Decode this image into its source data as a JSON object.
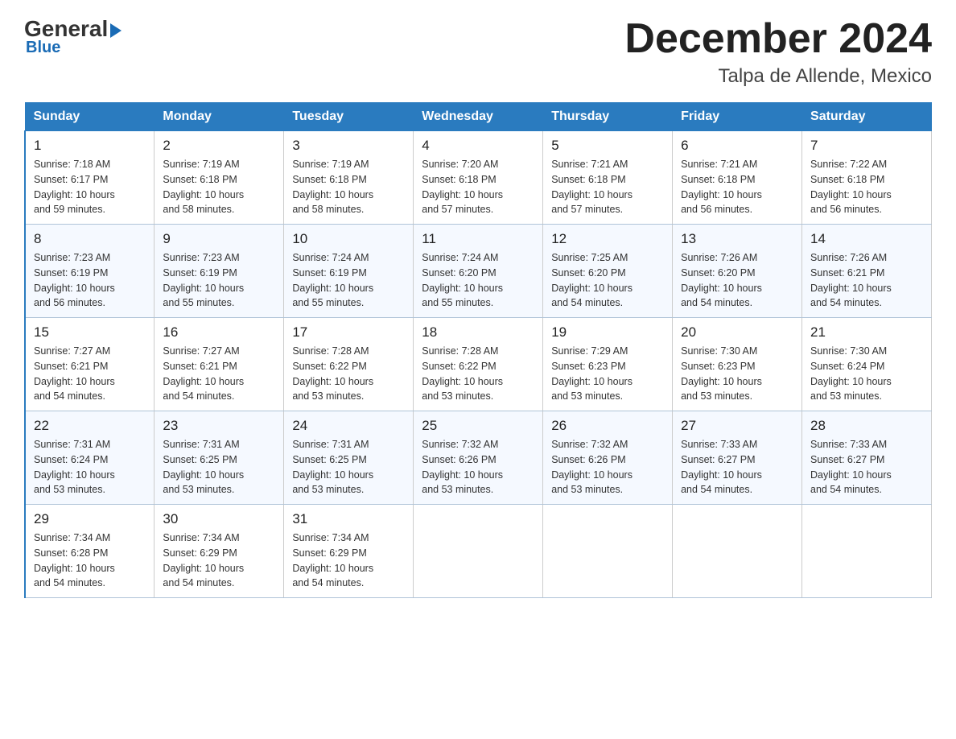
{
  "logo": {
    "general": "General",
    "blue": "Blue"
  },
  "header": {
    "month": "December 2024",
    "location": "Talpa de Allende, Mexico"
  },
  "days_of_week": [
    "Sunday",
    "Monday",
    "Tuesday",
    "Wednesday",
    "Thursday",
    "Friday",
    "Saturday"
  ],
  "weeks": [
    [
      {
        "day": "1",
        "sunrise": "7:18 AM",
        "sunset": "6:17 PM",
        "daylight": "10 hours and 59 minutes."
      },
      {
        "day": "2",
        "sunrise": "7:19 AM",
        "sunset": "6:18 PM",
        "daylight": "10 hours and 58 minutes."
      },
      {
        "day": "3",
        "sunrise": "7:19 AM",
        "sunset": "6:18 PM",
        "daylight": "10 hours and 58 minutes."
      },
      {
        "day": "4",
        "sunrise": "7:20 AM",
        "sunset": "6:18 PM",
        "daylight": "10 hours and 57 minutes."
      },
      {
        "day": "5",
        "sunrise": "7:21 AM",
        "sunset": "6:18 PM",
        "daylight": "10 hours and 57 minutes."
      },
      {
        "day": "6",
        "sunrise": "7:21 AM",
        "sunset": "6:18 PM",
        "daylight": "10 hours and 56 minutes."
      },
      {
        "day": "7",
        "sunrise": "7:22 AM",
        "sunset": "6:18 PM",
        "daylight": "10 hours and 56 minutes."
      }
    ],
    [
      {
        "day": "8",
        "sunrise": "7:23 AM",
        "sunset": "6:19 PM",
        "daylight": "10 hours and 56 minutes."
      },
      {
        "day": "9",
        "sunrise": "7:23 AM",
        "sunset": "6:19 PM",
        "daylight": "10 hours and 55 minutes."
      },
      {
        "day": "10",
        "sunrise": "7:24 AM",
        "sunset": "6:19 PM",
        "daylight": "10 hours and 55 minutes."
      },
      {
        "day": "11",
        "sunrise": "7:24 AM",
        "sunset": "6:20 PM",
        "daylight": "10 hours and 55 minutes."
      },
      {
        "day": "12",
        "sunrise": "7:25 AM",
        "sunset": "6:20 PM",
        "daylight": "10 hours and 54 minutes."
      },
      {
        "day": "13",
        "sunrise": "7:26 AM",
        "sunset": "6:20 PM",
        "daylight": "10 hours and 54 minutes."
      },
      {
        "day": "14",
        "sunrise": "7:26 AM",
        "sunset": "6:21 PM",
        "daylight": "10 hours and 54 minutes."
      }
    ],
    [
      {
        "day": "15",
        "sunrise": "7:27 AM",
        "sunset": "6:21 PM",
        "daylight": "10 hours and 54 minutes."
      },
      {
        "day": "16",
        "sunrise": "7:27 AM",
        "sunset": "6:21 PM",
        "daylight": "10 hours and 54 minutes."
      },
      {
        "day": "17",
        "sunrise": "7:28 AM",
        "sunset": "6:22 PM",
        "daylight": "10 hours and 53 minutes."
      },
      {
        "day": "18",
        "sunrise": "7:28 AM",
        "sunset": "6:22 PM",
        "daylight": "10 hours and 53 minutes."
      },
      {
        "day": "19",
        "sunrise": "7:29 AM",
        "sunset": "6:23 PM",
        "daylight": "10 hours and 53 minutes."
      },
      {
        "day": "20",
        "sunrise": "7:30 AM",
        "sunset": "6:23 PM",
        "daylight": "10 hours and 53 minutes."
      },
      {
        "day": "21",
        "sunrise": "7:30 AM",
        "sunset": "6:24 PM",
        "daylight": "10 hours and 53 minutes."
      }
    ],
    [
      {
        "day": "22",
        "sunrise": "7:31 AM",
        "sunset": "6:24 PM",
        "daylight": "10 hours and 53 minutes."
      },
      {
        "day": "23",
        "sunrise": "7:31 AM",
        "sunset": "6:25 PM",
        "daylight": "10 hours and 53 minutes."
      },
      {
        "day": "24",
        "sunrise": "7:31 AM",
        "sunset": "6:25 PM",
        "daylight": "10 hours and 53 minutes."
      },
      {
        "day": "25",
        "sunrise": "7:32 AM",
        "sunset": "6:26 PM",
        "daylight": "10 hours and 53 minutes."
      },
      {
        "day": "26",
        "sunrise": "7:32 AM",
        "sunset": "6:26 PM",
        "daylight": "10 hours and 53 minutes."
      },
      {
        "day": "27",
        "sunrise": "7:33 AM",
        "sunset": "6:27 PM",
        "daylight": "10 hours and 54 minutes."
      },
      {
        "day": "28",
        "sunrise": "7:33 AM",
        "sunset": "6:27 PM",
        "daylight": "10 hours and 54 minutes."
      }
    ],
    [
      {
        "day": "29",
        "sunrise": "7:34 AM",
        "sunset": "6:28 PM",
        "daylight": "10 hours and 54 minutes."
      },
      {
        "day": "30",
        "sunrise": "7:34 AM",
        "sunset": "6:29 PM",
        "daylight": "10 hours and 54 minutes."
      },
      {
        "day": "31",
        "sunrise": "7:34 AM",
        "sunset": "6:29 PM",
        "daylight": "10 hours and 54 minutes."
      },
      null,
      null,
      null,
      null
    ]
  ],
  "labels": {
    "sunrise": "Sunrise: ",
    "sunset": "Sunset: ",
    "daylight": "Daylight: "
  }
}
